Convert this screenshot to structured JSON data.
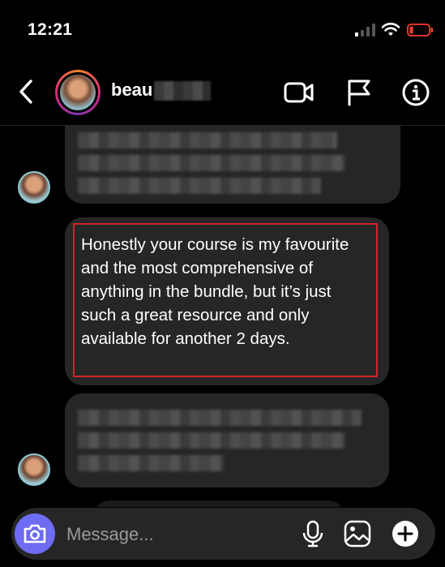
{
  "status_bar": {
    "time": "12:21"
  },
  "header": {
    "username": "beau",
    "icons": [
      "back-arrow-icon",
      "video-camera-icon",
      "flag-icon",
      "info-icon"
    ]
  },
  "messages": [
    {
      "type": "received",
      "text": "Honestly your course is my favourite and the most comprehensive of anything in the bundle, but it’s just such a great resource and only available for another 2 days."
    }
  ],
  "composer": {
    "placeholder": "Message...",
    "icons": [
      "camera-icon",
      "microphone-icon",
      "gallery-icon",
      "plus-icon"
    ]
  },
  "colors": {
    "background": "#000000",
    "bubble": "#262626",
    "highlight_border": "#d0242b",
    "camera_accent": "#6e6cf2",
    "battery_low": "#ff3b30"
  }
}
